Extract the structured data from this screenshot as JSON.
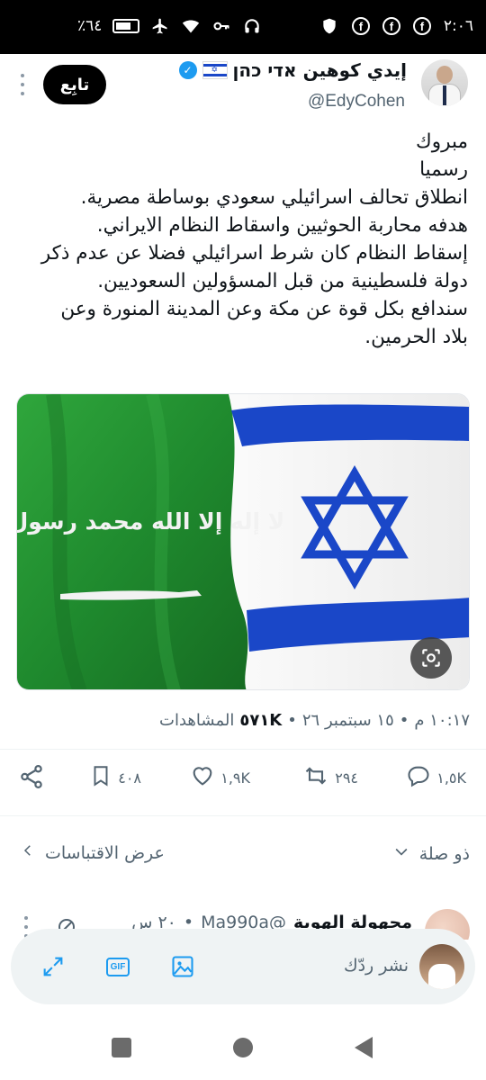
{
  "status_bar": {
    "time": "٢:٠٦",
    "battery": "٪٦٤"
  },
  "tweet": {
    "display_name": "إيدي كوهين אדי כהן",
    "handle": "@EdyCohen",
    "follow_label": "تابِع",
    "lines": [
      "مبروك",
      "رسميا",
      "انطلاق تحالف اسرائيلي سعودي بوساطة مصرية.",
      "هدفه محاربة الحوثيين واسقاط النظام الايراني.",
      "إسقاط النظام كان شرط اسرائيلي فضلا عن عدم ذكر",
      "دولة فلسطينية من قبل المسؤولين السعوديين.",
      "سندافع بكل قوة عن مكة وعن المدينة المنورة وعن",
      "بلاد الحرمين."
    ],
    "flag_inscription": "لا إله إلا الله محمد رسول الله",
    "meta": {
      "time": "١٠:١٧ م",
      "date": "١٥ سبتمبر ٢٦",
      "views_count": "٥٧١K",
      "views_label": "المشاهدات",
      "sep": "•"
    },
    "actions": {
      "replies": "١,٥K",
      "retweets": "٢٩٤",
      "likes": "١,٩K",
      "bookmarks": "٤٠٨"
    }
  },
  "related": {
    "relevance_label": "ذو صلة",
    "quotes_label": "عرض الاقتباسات"
  },
  "reply_preview": {
    "name": "مجهولة الهوية",
    "handle": "@Ma990a",
    "sep": "•",
    "time": "٢٠ س"
  },
  "composer": {
    "placeholder": "نشر ردّك",
    "gif_label": "GIF"
  },
  "colors": {
    "accent": "#1d9bf0",
    "saudi_green": "#1f8a2e",
    "israel_blue": "#1a47c8"
  }
}
